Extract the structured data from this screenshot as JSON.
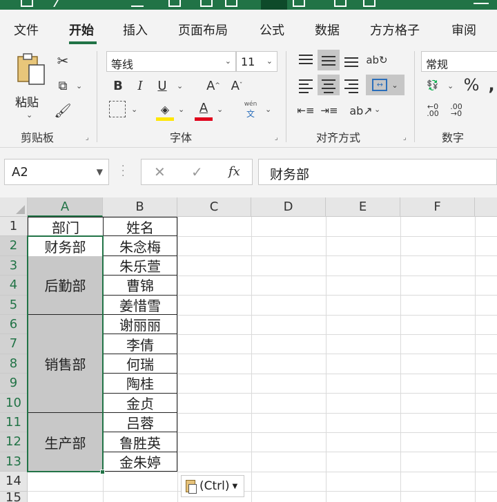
{
  "ribbon_tabs": [
    "文件",
    "开始",
    "插入",
    "页面布局",
    "公式",
    "数据",
    "方方格子",
    "审阅"
  ],
  "active_tab": "开始",
  "clipboard": {
    "paste_label": "粘贴",
    "group_label": "剪贴板"
  },
  "font": {
    "name": "等线",
    "size": "11",
    "group_label": "字体",
    "wen_top": "wén",
    "wen_bottom": "文"
  },
  "alignment": {
    "group_label": "对齐方式"
  },
  "number": {
    "format": "常规",
    "group_label": "数字"
  },
  "formula_bar": {
    "name_box": "A2",
    "fx_label": "fx",
    "content": "财务部"
  },
  "columns": [
    "A",
    "B",
    "C",
    "D",
    "E",
    "F"
  ],
  "rows": [
    "1",
    "2",
    "3",
    "4",
    "5",
    "6",
    "7",
    "8",
    "9",
    "10",
    "11",
    "12",
    "13",
    "14",
    "15"
  ],
  "headers": {
    "department": "部门",
    "name": "姓名"
  },
  "departments": [
    "财务部",
    "后勤部",
    "销售部",
    "生产部"
  ],
  "names": [
    "朱念梅",
    "朱乐萱",
    "曹锦",
    "姜惜雪",
    "谢丽丽",
    "李倩",
    "何瑞",
    "陶桂",
    "金贞",
    "吕蓉",
    "鲁胜英",
    "金朱婷"
  ],
  "paste_options": "(Ctrl)",
  "colors": {
    "accent": "#217346",
    "merged_fill": "#c8c8c8",
    "font_color": "#e0001b",
    "highlight": "#ffe600"
  }
}
